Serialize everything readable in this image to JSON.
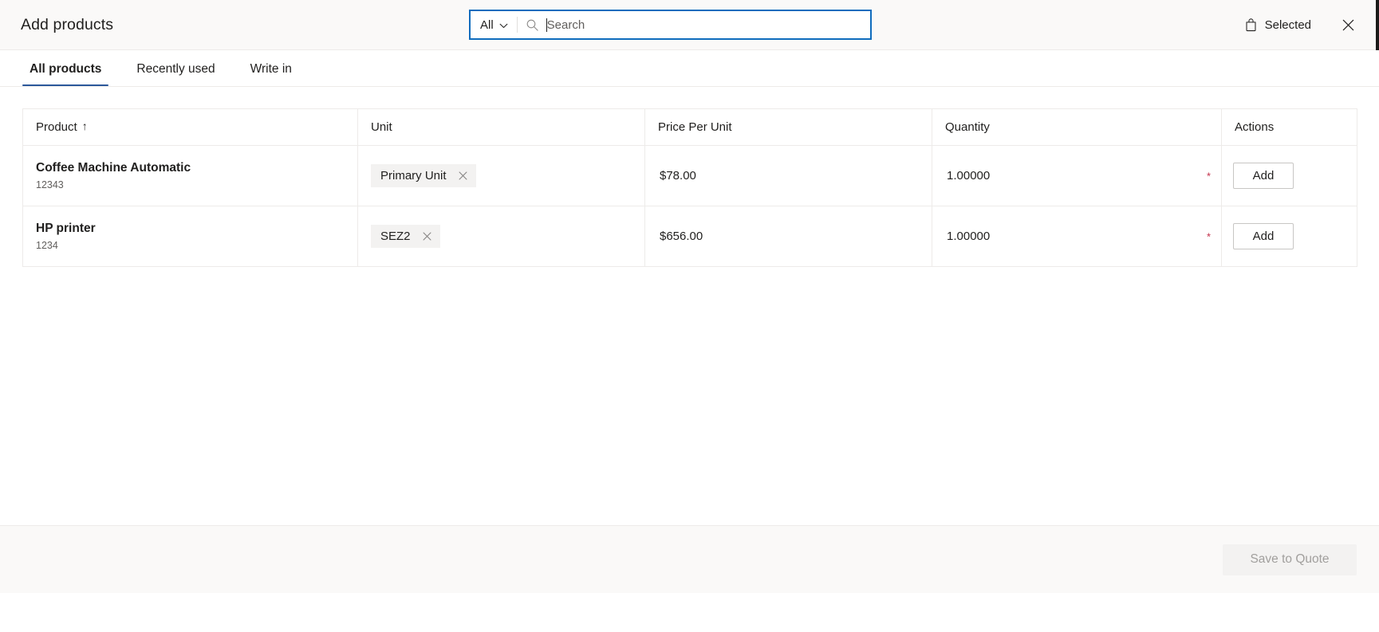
{
  "header": {
    "title": "Add products",
    "selected_label": "Selected",
    "bag_icon": "shopping-bag-icon",
    "close_icon": "close-icon"
  },
  "search": {
    "scope_label": "All",
    "scope_chevron_icon": "chevron-down-icon",
    "search_icon": "search-icon",
    "placeholder": "Search",
    "value": ""
  },
  "tabs": [
    {
      "label": "All products",
      "active": true
    },
    {
      "label": "Recently used",
      "active": false
    },
    {
      "label": "Write in",
      "active": false
    }
  ],
  "table": {
    "columns": [
      {
        "label": "Product",
        "sort": "↑"
      },
      {
        "label": "Unit",
        "sort": ""
      },
      {
        "label": "Price Per Unit",
        "sort": ""
      },
      {
        "label": "Quantity",
        "sort": ""
      },
      {
        "label": "Actions",
        "sort": ""
      }
    ],
    "rows": [
      {
        "product_name": "Coffee Machine Automatic",
        "product_id": "12343",
        "unit": "Primary Unit",
        "unit_remove_icon": "close-icon",
        "price_per_unit": "$78.00",
        "quantity": "1.00000",
        "quantity_required_marker": "*",
        "action_label": "Add"
      },
      {
        "product_name": "HP printer",
        "product_id": "1234",
        "unit": "SEZ2",
        "unit_remove_icon": "close-icon",
        "price_per_unit": "$656.00",
        "quantity": "1.00000",
        "quantity_required_marker": "*",
        "action_label": "Add"
      }
    ]
  },
  "footer": {
    "save_label": "Save to Quote",
    "save_disabled": true
  },
  "colors": {
    "accent": "#2b579a",
    "focus_border": "#0f6cbd",
    "header_bg": "#faf9f8",
    "border": "#edebe9",
    "pill_bg": "#f3f2f1",
    "required_red": "#c4314b",
    "muted_text": "#605e5c",
    "disabled_text": "#a19f9d"
  }
}
